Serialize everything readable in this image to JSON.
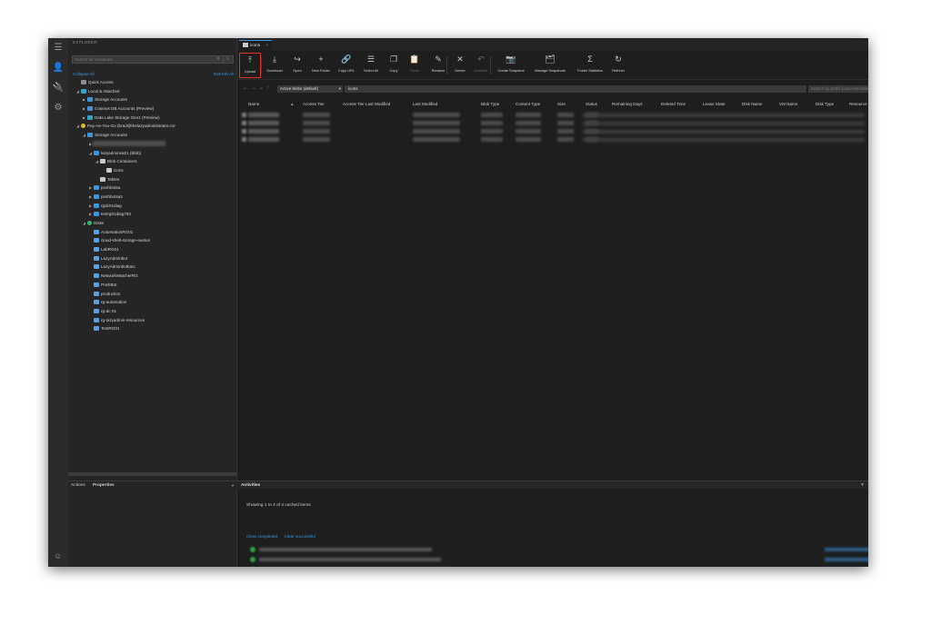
{
  "explorer": {
    "header": "EXPLORER",
    "search_placeholder": "Search for resources",
    "collapse_all": "Collapse All",
    "refresh_all": "Refresh All",
    "tree": [
      {
        "label": "Quick Access",
        "depth": 0,
        "twisty": "",
        "icon": "grey"
      },
      {
        "label": "Local & Attached",
        "depth": 0,
        "twisty": "◢",
        "icon": "teal"
      },
      {
        "label": "Storage Accounts",
        "depth": 1,
        "twisty": "▶",
        "icon": "blue"
      },
      {
        "label": "Cosmos DB Accounts (Preview)",
        "depth": 1,
        "twisty": "▶",
        "icon": "cube"
      },
      {
        "label": "Data Lake Storage Gen1 (Preview)",
        "depth": 1,
        "twisty": "▶",
        "icon": "teal"
      },
      {
        "label": "Pay-As-You-Go (brad@thelazyadministrator.cor",
        "depth": 0,
        "twisty": "◢",
        "icon": "gold"
      },
      {
        "label": "Storage Accounts",
        "depth": 1,
        "twisty": "◢",
        "icon": "blue"
      },
      {
        "label": "",
        "depth": 2,
        "twisty": "▶",
        "icon": "",
        "blurred": true
      },
      {
        "label": "lazyadminsa01 (Blob)",
        "depth": 2,
        "twisty": "◢",
        "icon": "blue"
      },
      {
        "label": "Blob Containers",
        "depth": 3,
        "twisty": "◢",
        "icon": "folder"
      },
      {
        "label": "icons",
        "depth": 4,
        "twisty": "",
        "icon": "folder",
        "selected": true
      },
      {
        "label": "Tables",
        "depth": 3,
        "twisty": "",
        "icon": "folder"
      },
      {
        "label": "poshbotsa",
        "depth": 2,
        "twisty": "▶",
        "icon": "blue"
      },
      {
        "label": "poshbotsa2",
        "depth": 2,
        "twisty": "▶",
        "icon": "blue"
      },
      {
        "label": "rgdc01diag",
        "depth": 2,
        "twisty": "▶",
        "icon": "blue"
      },
      {
        "label": "testrg01diag793",
        "depth": 2,
        "twisty": "▶",
        "icon": "blue"
      },
      {
        "label": "Disks",
        "depth": 1,
        "twisty": "◢",
        "icon": "green"
      },
      {
        "label": "AutomationRG01",
        "depth": 2,
        "twisty": "",
        "icon": "disk"
      },
      {
        "label": "cloud-shell-storage-eastus",
        "depth": 2,
        "twisty": "",
        "icon": "disk"
      },
      {
        "label": "LabRG01",
        "depth": 2,
        "twisty": "",
        "icon": "disk"
      },
      {
        "label": "LazyAdminbot",
        "depth": 2,
        "twisty": "",
        "icon": "disk"
      },
      {
        "label": "LazyAdminbotbotc",
        "depth": 2,
        "twisty": "",
        "icon": "disk"
      },
      {
        "label": "NetworkWatcherRG",
        "depth": 2,
        "twisty": "",
        "icon": "disk"
      },
      {
        "label": "PoshBot",
        "depth": 2,
        "twisty": "",
        "icon": "disk"
      },
      {
        "label": "production",
        "depth": 2,
        "twisty": "",
        "icon": "disk"
      },
      {
        "label": "rg-automation",
        "depth": 2,
        "twisty": "",
        "icon": "disk"
      },
      {
        "label": "rg-dc-01",
        "depth": 2,
        "twisty": "",
        "icon": "disk"
      },
      {
        "label": "rg-lazyadmin-resources",
        "depth": 2,
        "twisty": "",
        "icon": "disk"
      },
      {
        "label": "TestRG01",
        "depth": 2,
        "twisty": "",
        "icon": "disk"
      }
    ]
  },
  "bottom_left": {
    "actions": "Actions",
    "properties": "Properties"
  },
  "editor_tab": {
    "label": "icons",
    "close": "×"
  },
  "toolbar": [
    {
      "glyph": "⤒",
      "label": "Upload",
      "highlight": true
    },
    {
      "glyph": "⤓",
      "label": "Download"
    },
    {
      "glyph": "↪",
      "label": "Open"
    },
    {
      "glyph": "+",
      "label": "New Folder"
    },
    {
      "glyph": "🔗",
      "label": "Copy URL"
    },
    {
      "glyph": "☰",
      "label": "Select All"
    },
    {
      "glyph": "❐",
      "label": "Copy"
    },
    {
      "glyph": "📋",
      "label": "Paste",
      "disabled": true
    },
    {
      "glyph": "✎",
      "label": "Rename"
    },
    {
      "glyph": "✕",
      "label": "Delete"
    },
    {
      "glyph": "↶",
      "label": "Undelete",
      "disabled": true
    },
    {
      "glyph": "📷",
      "label": "Create Snapshot"
    },
    {
      "glyph": "🗂",
      "label": "Manage Snapshots"
    },
    {
      "glyph": "Σ",
      "label": "Folder Statistics"
    },
    {
      "glyph": "↻",
      "label": "Refresh"
    }
  ],
  "address": {
    "view": "Active blobs (default)",
    "path": "icons",
    "prefix_placeholder": "Search by prefix (case-sensitive)"
  },
  "grid": {
    "columns": [
      "Name",
      "Access Tier",
      "Access Tier Last Modified",
      "Last Modified",
      "Blob Type",
      "Content Type",
      "Size",
      "Status",
      "Remaining Days",
      "Deleted Time",
      "Lease State",
      "Disk Name",
      "VM Name",
      "Disk Type",
      "Resource Group Name"
    ],
    "row_count": 4,
    "status": "Showing 1 to 4 of 4 cached items"
  },
  "activities": {
    "title": "Activities",
    "clear_completed": "Clear completed",
    "clear_successful": "Clear successful",
    "row_count": 4
  }
}
